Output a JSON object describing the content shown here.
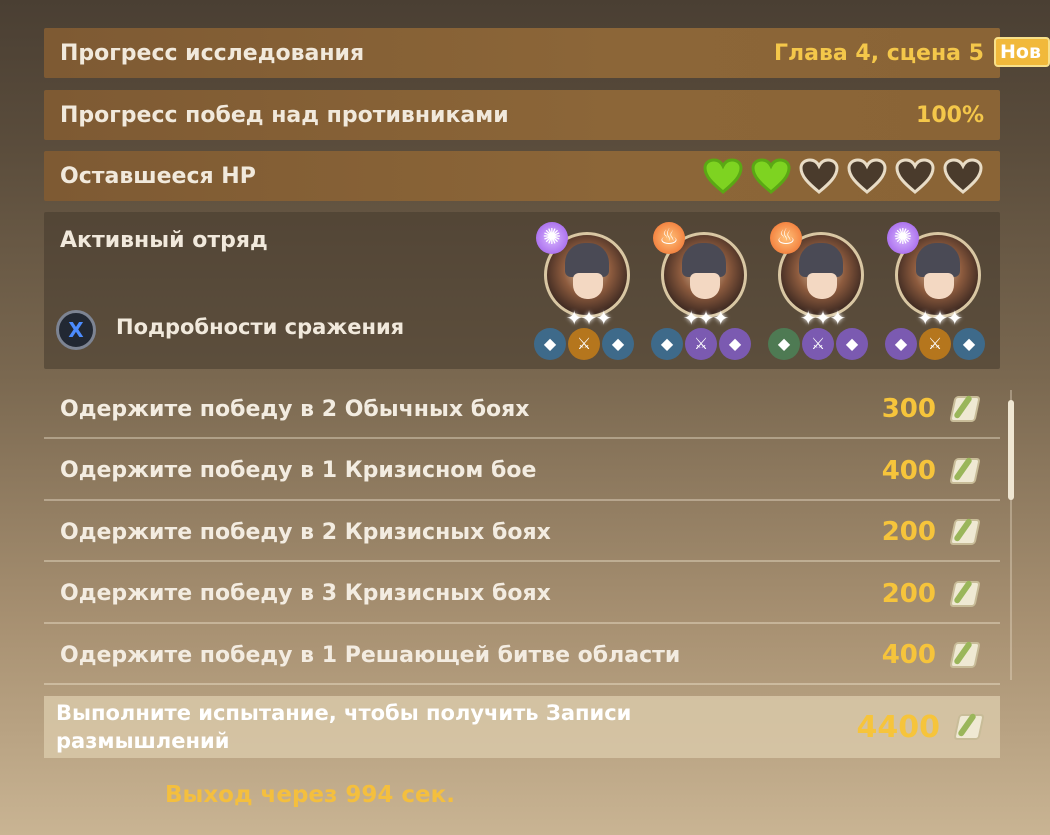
{
  "exploration": {
    "label": "Прогресс исследования",
    "value": "Глава 4, сцена 5",
    "new_badge": "Нов"
  },
  "enemies": {
    "label": "Прогресс побед над противниками",
    "value": "100%"
  },
  "hp": {
    "label": "Оставшееся HP",
    "filled": 2,
    "total": 6,
    "filled_color": "#7ed321",
    "empty_color": "#4a3b2c"
  },
  "team": {
    "title": "Активный отряд",
    "details_button_key": "X",
    "details_label": "Подробности сражения",
    "members": [
      {
        "element": "electro",
        "stars": "✦✦✦",
        "gear": [
          "g-blue",
          "g-orange",
          "g-blue"
        ]
      },
      {
        "element": "pyro",
        "stars": "✦✦✦",
        "gear": [
          "g-blue",
          "g-purple",
          "g-purple"
        ]
      },
      {
        "element": "pyro",
        "stars": "✦✦✦",
        "gear": [
          "g-green",
          "g-purple",
          "g-purple"
        ]
      },
      {
        "element": "electro",
        "stars": "✦✦✦",
        "gear": [
          "g-purple",
          "g-orange",
          "g-blue"
        ]
      }
    ]
  },
  "challenges": [
    {
      "label": "Одержите победу в 2 Обычных боях",
      "amount": "300"
    },
    {
      "label": "Одержите победу в 1 Кризисном бое",
      "amount": "400"
    },
    {
      "label": "Одержите победу в 2 Кризисных боях",
      "amount": "200"
    },
    {
      "label": "Одержите победу в 3 Кризисных боях",
      "amount": "200"
    },
    {
      "label": "Одержите победу в 1 Решающей битве области",
      "amount": "400"
    }
  ],
  "final": {
    "label": "Выполните испытание, чтобы получить Записи размышлений",
    "amount": "4400"
  },
  "exit": {
    "label": "Выход через 994 сек."
  }
}
